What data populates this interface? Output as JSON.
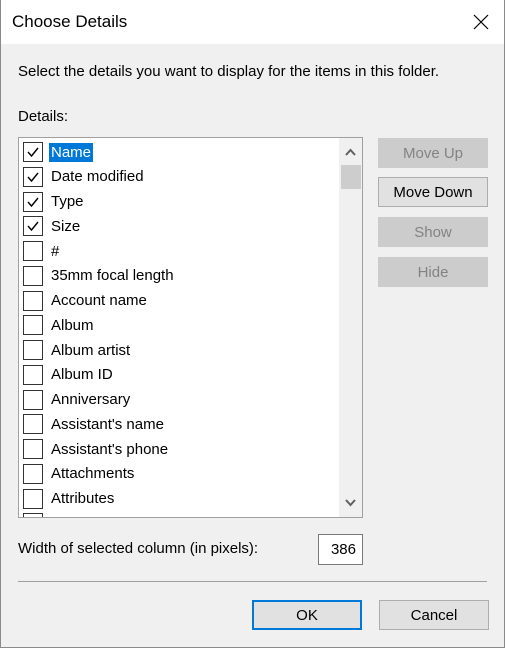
{
  "window": {
    "title": "Choose Details",
    "close_icon": "close-icon"
  },
  "description": "Select the details you want to display for the items in this folder.",
  "details_label": "Details:",
  "details_list": {
    "items": [
      {
        "label": "Name",
        "checked": true,
        "selected": true
      },
      {
        "label": "Date modified",
        "checked": true,
        "selected": false
      },
      {
        "label": "Type",
        "checked": true,
        "selected": false
      },
      {
        "label": "Size",
        "checked": true,
        "selected": false
      },
      {
        "label": "#",
        "checked": false,
        "selected": false
      },
      {
        "label": "35mm focal length",
        "checked": false,
        "selected": false
      },
      {
        "label": "Account name",
        "checked": false,
        "selected": false
      },
      {
        "label": "Album",
        "checked": false,
        "selected": false
      },
      {
        "label": "Album artist",
        "checked": false,
        "selected": false
      },
      {
        "label": "Album ID",
        "checked": false,
        "selected": false
      },
      {
        "label": "Anniversary",
        "checked": false,
        "selected": false
      },
      {
        "label": "Assistant's name",
        "checked": false,
        "selected": false
      },
      {
        "label": "Assistant's phone",
        "checked": false,
        "selected": false
      },
      {
        "label": "Attachments",
        "checked": false,
        "selected": false
      },
      {
        "label": "Attributes",
        "checked": false,
        "selected": false
      },
      {
        "label": "",
        "checked": false,
        "selected": false
      }
    ]
  },
  "side_buttons": {
    "move_up": {
      "label": "Move Up",
      "enabled": false
    },
    "move_down": {
      "label": "Move Down",
      "enabled": true
    },
    "show": {
      "label": "Show",
      "enabled": false
    },
    "hide": {
      "label": "Hide",
      "enabled": false
    }
  },
  "width_field": {
    "label": "Width of selected column (in pixels):",
    "value": "386"
  },
  "buttons": {
    "ok": "OK",
    "cancel": "Cancel"
  },
  "colors": {
    "selection": "#0078d7",
    "dialog_bg": "#f0f0f0",
    "disabled_text": "#838383"
  }
}
